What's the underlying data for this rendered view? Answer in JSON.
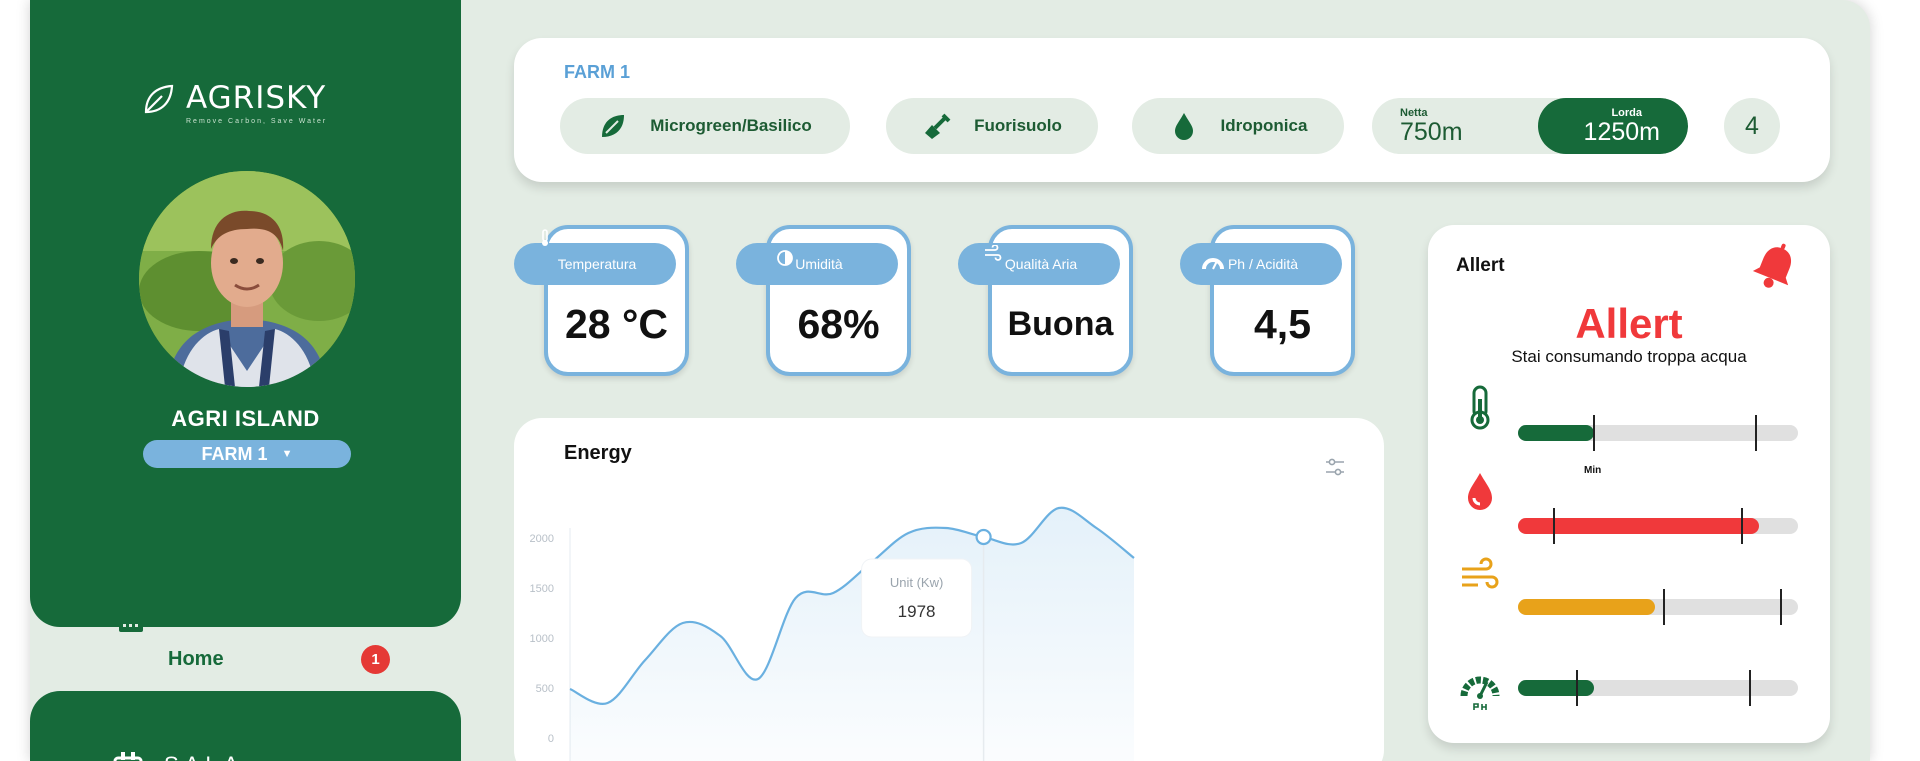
{
  "brand": {
    "name": "AGRISKY",
    "tagline": "Remove Carbon, Save Water"
  },
  "sidebar": {
    "farm_name": "AGRI ISLAND",
    "farm_select": "FARM 1",
    "nav": [
      {
        "label": "Home",
        "badge": "1"
      },
      {
        "label": "SALA"
      }
    ]
  },
  "farm": {
    "title": "FARM 1",
    "pills": [
      {
        "label": "Microgreen/Basilico",
        "icon": "leaf-icon"
      },
      {
        "label": "Fuorisuolo",
        "icon": "shovel-icon"
      },
      {
        "label": "Idroponica",
        "icon": "water-drop-icon"
      }
    ],
    "area": {
      "net_label": "Netta",
      "net_value": "750m",
      "gross_label": "Lorda",
      "gross_value": "1250m"
    },
    "count": "4"
  },
  "sensors": [
    {
      "label": "Temperatura",
      "value": "28 °C",
      "icon": "thermometer-icon"
    },
    {
      "label": "Umidità",
      "value": "68%",
      "icon": "humidity-icon"
    },
    {
      "label": "Qualità Aria",
      "value": "Buona",
      "icon": "wind-icon"
    },
    {
      "label": "Ph / Acidità",
      "value": "4,5",
      "icon": "ph-gauge-icon"
    }
  ],
  "energy": {
    "title": "Energy",
    "tooltip": {
      "label": "Unit (Kw)",
      "value": "1978"
    }
  },
  "chart_data": {
    "type": "area",
    "title": "Energy",
    "xlabel": "",
    "ylabel": "",
    "ylim": [
      0,
      2000
    ],
    "yticks": [
      "2000",
      "1500",
      "1000",
      "500",
      "0"
    ],
    "x": [
      0,
      1,
      2,
      3,
      4,
      5,
      6,
      7,
      8,
      9,
      10,
      11,
      12,
      13,
      14,
      15
    ],
    "values": [
      490,
      350,
      780,
      1150,
      1020,
      590,
      1400,
      1450,
      1750,
      2050,
      2100,
      2010,
      1950,
      2300,
      2100,
      1800
    ],
    "highlight_index": 11,
    "highlight_value": 1978,
    "color": "#6ab0e0",
    "grid": false
  },
  "alert": {
    "header": "Allert",
    "title": "Allert",
    "message": "Stai consumando troppa acqua",
    "min_label": "Min",
    "gauges": [
      {
        "icon": "thermometer-icon",
        "fill": 0.27,
        "color": "#166a3a",
        "ticks": [
          0.27,
          0.85
        ]
      },
      {
        "icon": "water-drop-icon",
        "fill": 0.86,
        "color": "#f0393b",
        "ticks": [
          0.13,
          0.8
        ]
      },
      {
        "icon": "wind-icon",
        "fill": 0.49,
        "color": "#e8a21a",
        "ticks": [
          0.52,
          0.94
        ]
      },
      {
        "icon": "ph-gauge-icon",
        "fill": 0.27,
        "color": "#166a3a",
        "ticks": [
          0.21,
          0.83
        ]
      }
    ]
  }
}
